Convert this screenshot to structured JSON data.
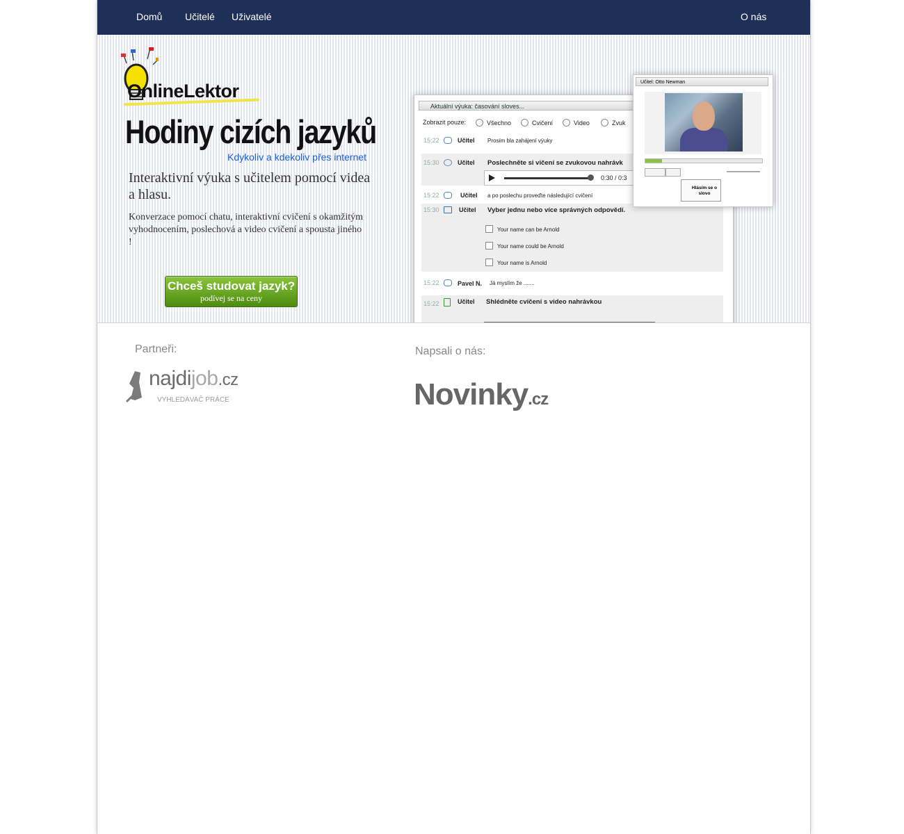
{
  "nav": {
    "home": "Domů",
    "teachers": "Učitelé",
    "users": "Uživatelé",
    "about": "O nás"
  },
  "hero": {
    "logo": "OnlineLektor",
    "headline": "Hodiny cizích jazyků",
    "tagline": "Kdykoliv a kdekoliv přes internet",
    "intro_main": "Interaktivní výuka s učitelem pomocí videa a hlasu.",
    "intro_sub": "Konverzace pomocí chatu, interaktivní cvičení s okamžitým vyhodnocením, poslechová a video cvičení a spousta jiného !",
    "cta_line1": "Chceš studovat jazyk?",
    "cta_line2": "podívej se na ceny"
  },
  "mockup": {
    "title": "Aktuální výuka: časování sloves...",
    "filter_label": "Zobrazit pouze:",
    "filters": [
      "Všechno",
      "Cvičení",
      "Video",
      "Zvuk"
    ],
    "rows": [
      {
        "time": "15:22",
        "who": "Učitel",
        "msg": "Prosím bla zahájení výuky"
      },
      {
        "time": "15:30",
        "who": "Učitel",
        "msg": "Poslechněte si vičení se zvukovou nahrávk"
      },
      {
        "time": "15:22",
        "who": "Učitel",
        "msg": "a po poslechu proveďte následující cvičení"
      },
      {
        "time": "15:30",
        "who": "Učitel",
        "msg": "Vyber jednu nebo více správných odpovědí."
      },
      {
        "time": "15:22",
        "who": "Pavel N.",
        "msg": "Já myslím že ......."
      },
      {
        "time": "15:22",
        "who": "Učitel",
        "msg": "Shlédněte cvičení s video nahrávkou"
      }
    ],
    "player_time": "0:30 / 0:3",
    "choices": [
      "Your name can be Arnold",
      "Your name could be Arnold",
      "Your name is Arnold"
    ]
  },
  "popup": {
    "title": "Učitel: Otto Newman",
    "button": "Hlásím se o slovo"
  },
  "partners": {
    "label": "Partneři:",
    "najdi_main": "najdi",
    "najdi_job": "job",
    "najdi_tld": ".cz",
    "najdi_sub": "VYHLEDÁVAČ PRÁCE"
  },
  "press": {
    "label": "Napsali o nás:",
    "novinky": "Novinky",
    "novinky_tld": ".cz"
  }
}
